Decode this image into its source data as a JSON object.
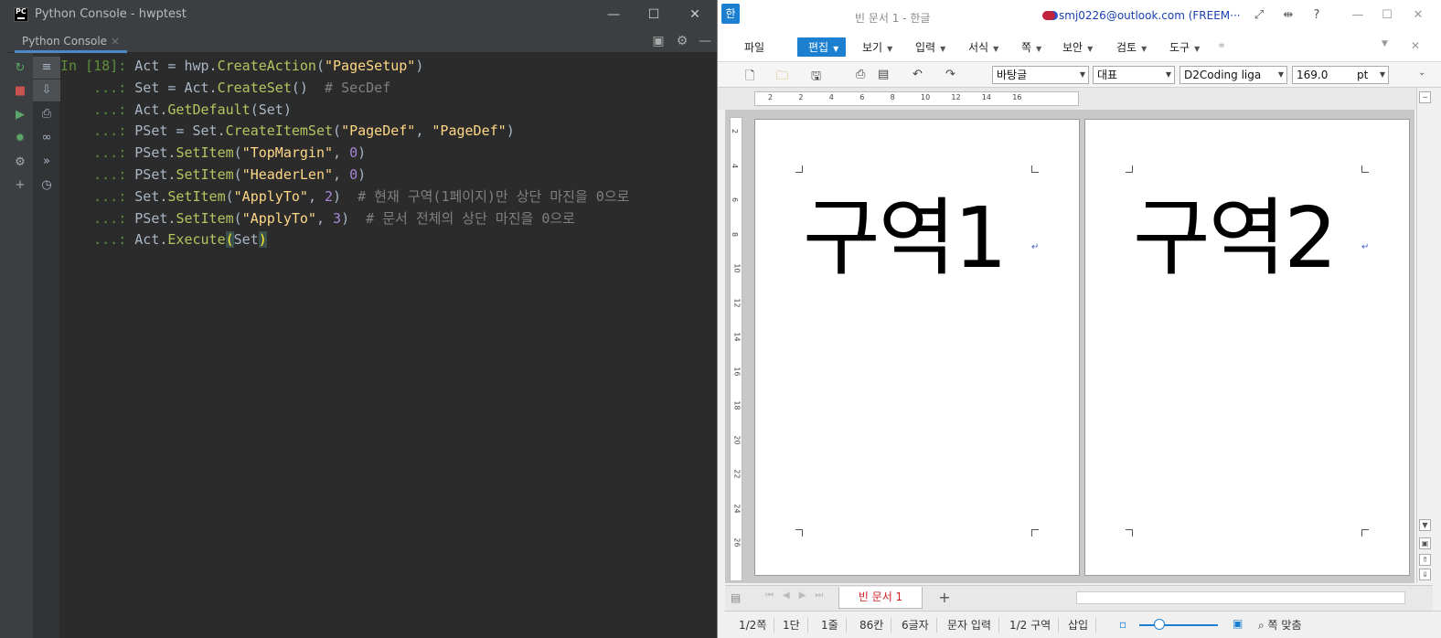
{
  "pycharm": {
    "window_title": "Python Console - hwptest",
    "logo_text": "PC",
    "tab_label": "Python Console",
    "tab_close": "×",
    "minimize": "—",
    "maximize": "☐",
    "close": "✕",
    "code_lines": [
      [
        {
          "t": "In [18]: ",
          "c": "pr"
        },
        {
          "t": "Act = hwp.",
          "c": ""
        },
        {
          "t": "CreateAction",
          "c": "fn"
        },
        {
          "t": "(",
          "c": ""
        },
        {
          "t": "\"PageSetup\"",
          "c": "st"
        },
        {
          "t": ")",
          "c": ""
        }
      ],
      [
        {
          "t": "    ...: ",
          "c": "pr"
        },
        {
          "t": "Set = Act.",
          "c": ""
        },
        {
          "t": "CreateSet",
          "c": "fn"
        },
        {
          "t": "()  ",
          "c": ""
        },
        {
          "t": "# SecDef",
          "c": "cm"
        }
      ],
      [
        {
          "t": "    ...: ",
          "c": "pr"
        },
        {
          "t": "Act.",
          "c": ""
        },
        {
          "t": "GetDefault",
          "c": "fn"
        },
        {
          "t": "(Set)",
          "c": ""
        }
      ],
      [
        {
          "t": "    ...: ",
          "c": "pr"
        },
        {
          "t": "PSet = Set.",
          "c": ""
        },
        {
          "t": "CreateItemSet",
          "c": "fn"
        },
        {
          "t": "(",
          "c": ""
        },
        {
          "t": "\"PageDef\"",
          "c": "st"
        },
        {
          "t": ", ",
          "c": ""
        },
        {
          "t": "\"PageDef\"",
          "c": "st"
        },
        {
          "t": ")",
          "c": ""
        }
      ],
      [
        {
          "t": "    ...: ",
          "c": "pr"
        },
        {
          "t": "PSet.",
          "c": ""
        },
        {
          "t": "SetItem",
          "c": "fn"
        },
        {
          "t": "(",
          "c": ""
        },
        {
          "t": "\"TopMargin\"",
          "c": "st"
        },
        {
          "t": ", ",
          "c": ""
        },
        {
          "t": "0",
          "c": "nu"
        },
        {
          "t": ")",
          "c": ""
        }
      ],
      [
        {
          "t": "    ...: ",
          "c": "pr"
        },
        {
          "t": "PSet.",
          "c": ""
        },
        {
          "t": "SetItem",
          "c": "fn"
        },
        {
          "t": "(",
          "c": ""
        },
        {
          "t": "\"HeaderLen\"",
          "c": "st"
        },
        {
          "t": ", ",
          "c": ""
        },
        {
          "t": "0",
          "c": "nu"
        },
        {
          "t": ")",
          "c": ""
        }
      ],
      [
        {
          "t": "    ...: ",
          "c": "pr"
        },
        {
          "t": "Set.",
          "c": ""
        },
        {
          "t": "SetItem",
          "c": "fn"
        },
        {
          "t": "(",
          "c": ""
        },
        {
          "t": "\"ApplyTo\"",
          "c": "st"
        },
        {
          "t": ", ",
          "c": ""
        },
        {
          "t": "2",
          "c": "nu"
        },
        {
          "t": ")  ",
          "c": ""
        },
        {
          "t": "# 현재 구역(1페이지)만 상단 마진을 0으로",
          "c": "cm"
        }
      ],
      [
        {
          "t": "    ...: ",
          "c": "pr"
        },
        {
          "t": "PSet.",
          "c": ""
        },
        {
          "t": "SetItem",
          "c": "fn"
        },
        {
          "t": "(",
          "c": ""
        },
        {
          "t": "\"ApplyTo\"",
          "c": "st"
        },
        {
          "t": ", ",
          "c": ""
        },
        {
          "t": "3",
          "c": "nu"
        },
        {
          "t": ")  ",
          "c": ""
        },
        {
          "t": "# 문서 전체의 상단 마진을 0으로",
          "c": "cm"
        }
      ],
      [
        {
          "t": "    ...: ",
          "c": "pr"
        },
        {
          "t": "Act.",
          "c": ""
        },
        {
          "t": "Execute",
          "c": "fn"
        },
        {
          "t": "(",
          "c": "brk"
        },
        {
          "t": "Set",
          "c": ""
        },
        {
          "t": ")",
          "c": "brk"
        }
      ]
    ]
  },
  "hangul": {
    "logo_text": "한",
    "doc_title": "빈 문서 1 - 한글",
    "user": "smj0226@outlook.com (FREEM···",
    "help": "?",
    "menus": [
      "파일",
      "편집",
      "보기",
      "입력",
      "서식",
      "쪽",
      "보안",
      "검토",
      "도구"
    ],
    "style_combo": "바탕글",
    "font_combo": "대표",
    "typeface_combo": "D2Coding liga",
    "size_combo": "169.0",
    "size_unit": "pt",
    "ruler_numbers": [
      "2",
      "2",
      "4",
      "6",
      "8",
      "10",
      "12",
      "14",
      "16"
    ],
    "vruler_numbers": [
      "2",
      "4",
      "6",
      "8",
      "10",
      "12",
      "14",
      "16",
      "18",
      "20",
      "22",
      "24",
      "26"
    ],
    "page1_text": "구역1",
    "page2_text": "구역2",
    "doc_tab": "빈 문서 1",
    "add_tab": "+",
    "status": [
      "1/2쪽",
      "1단",
      "1줄",
      "86칸",
      "6글자",
      "문자 입력",
      "1/2 구역",
      "삽입"
    ],
    "fit_label": "쪽 맞춤"
  }
}
